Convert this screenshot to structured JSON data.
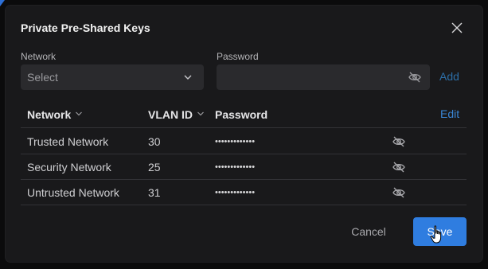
{
  "dialog": {
    "title": "Private Pre-Shared Keys",
    "network_label": "Network",
    "network_select_value": "Select",
    "password_label": "Password",
    "password_value": "",
    "add_label": "Add"
  },
  "table": {
    "columns": [
      "Network",
      "VLAN ID",
      "Password"
    ],
    "edit_label": "Edit",
    "rows": [
      {
        "network": "Trusted Network",
        "vlan": "30",
        "password": "•••••••••••••"
      },
      {
        "network": "Security Network",
        "vlan": "25",
        "password": "•••••••••••••"
      },
      {
        "network": "Untrusted Network",
        "vlan": "31",
        "password": "•••••••••••••"
      }
    ]
  },
  "footer": {
    "cancel_label": "Cancel",
    "save_label": "Save"
  },
  "colors": {
    "accent": "#2f7de0",
    "link": "#3a86d6",
    "modal_bg": "#19191b"
  },
  "icons": [
    "close-icon",
    "chevron-down-icon",
    "eye-off-icon",
    "sort-icon",
    "pointer-cursor-icon"
  ]
}
